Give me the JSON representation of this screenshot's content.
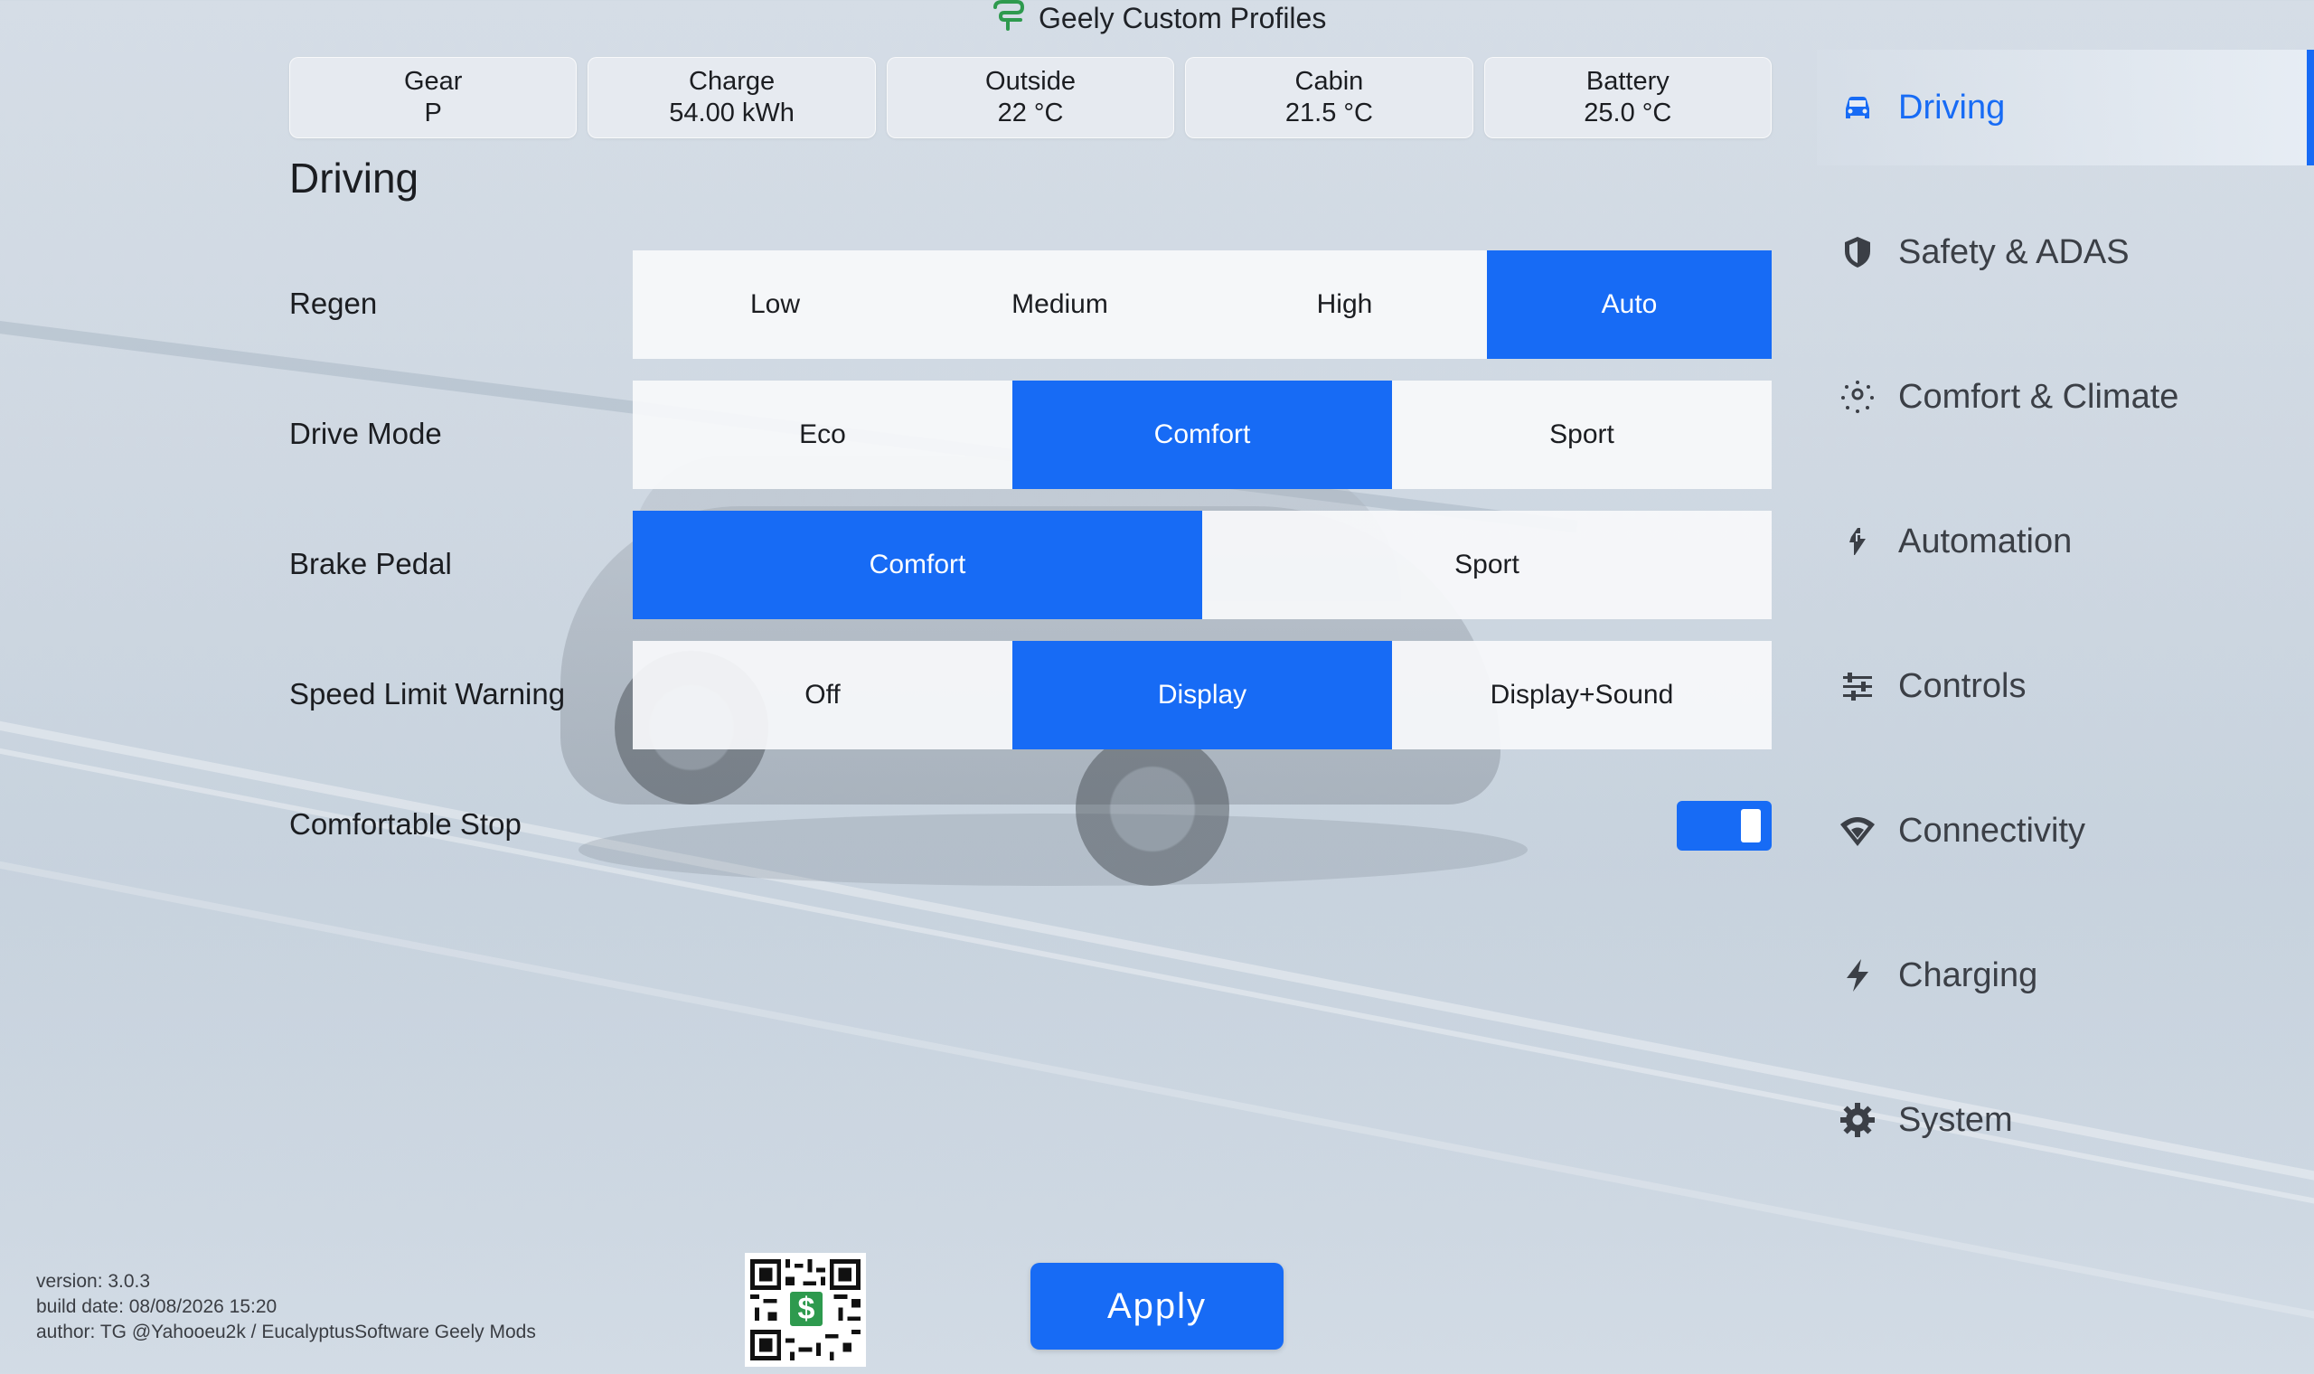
{
  "app_title": "Geely Custom Profiles",
  "status": [
    {
      "label": "Gear",
      "value": "P"
    },
    {
      "label": "Charge",
      "value": "54.00 kWh"
    },
    {
      "label": "Outside",
      "value": "22 °C"
    },
    {
      "label": "Cabin",
      "value": "21.5 °C"
    },
    {
      "label": "Battery",
      "value": "25.0 °C"
    }
  ],
  "section_title": "Driving",
  "settings": {
    "regen": {
      "label": "Regen",
      "options": [
        "Low",
        "Medium",
        "High",
        "Auto"
      ],
      "selected": "Auto"
    },
    "drive_mode": {
      "label": "Drive Mode",
      "options": [
        "Eco",
        "Comfort",
        "Sport"
      ],
      "selected": "Comfort"
    },
    "brake_pedal": {
      "label": "Brake Pedal",
      "options": [
        "Comfort",
        "Sport"
      ],
      "selected": "Comfort"
    },
    "speed_limit_warning": {
      "label": "Speed Limit Warning",
      "options": [
        "Off",
        "Display",
        "Display+Sound"
      ],
      "selected": "Display"
    },
    "comfortable_stop": {
      "label": "Comfortable Stop",
      "enabled": true
    }
  },
  "nav": [
    {
      "label": "Driving",
      "icon": "car-icon",
      "active": true
    },
    {
      "label": "Safety & ADAS",
      "icon": "shield-icon",
      "active": false
    },
    {
      "label": "Comfort & Climate",
      "icon": "sun-icon",
      "active": false
    },
    {
      "label": "Automation",
      "icon": "automation-icon",
      "active": false
    },
    {
      "label": "Controls",
      "icon": "sliders-icon",
      "active": false
    },
    {
      "label": "Connectivity",
      "icon": "wifi-icon",
      "active": false
    },
    {
      "label": "Charging",
      "icon": "bolt-icon",
      "active": false
    },
    {
      "label": "System",
      "icon": "gear-icon",
      "active": false
    }
  ],
  "footer": {
    "version": "version: 3.0.3",
    "build_date": "build date: 08/08/2026 15:20",
    "author": "author: TG @Yahooeu2k / EucalyptusSoftware Geely Mods",
    "qr_symbol": "$"
  },
  "apply_label": "Apply",
  "colors": {
    "accent": "#176bf5",
    "logo_green": "#2e9a4e"
  }
}
